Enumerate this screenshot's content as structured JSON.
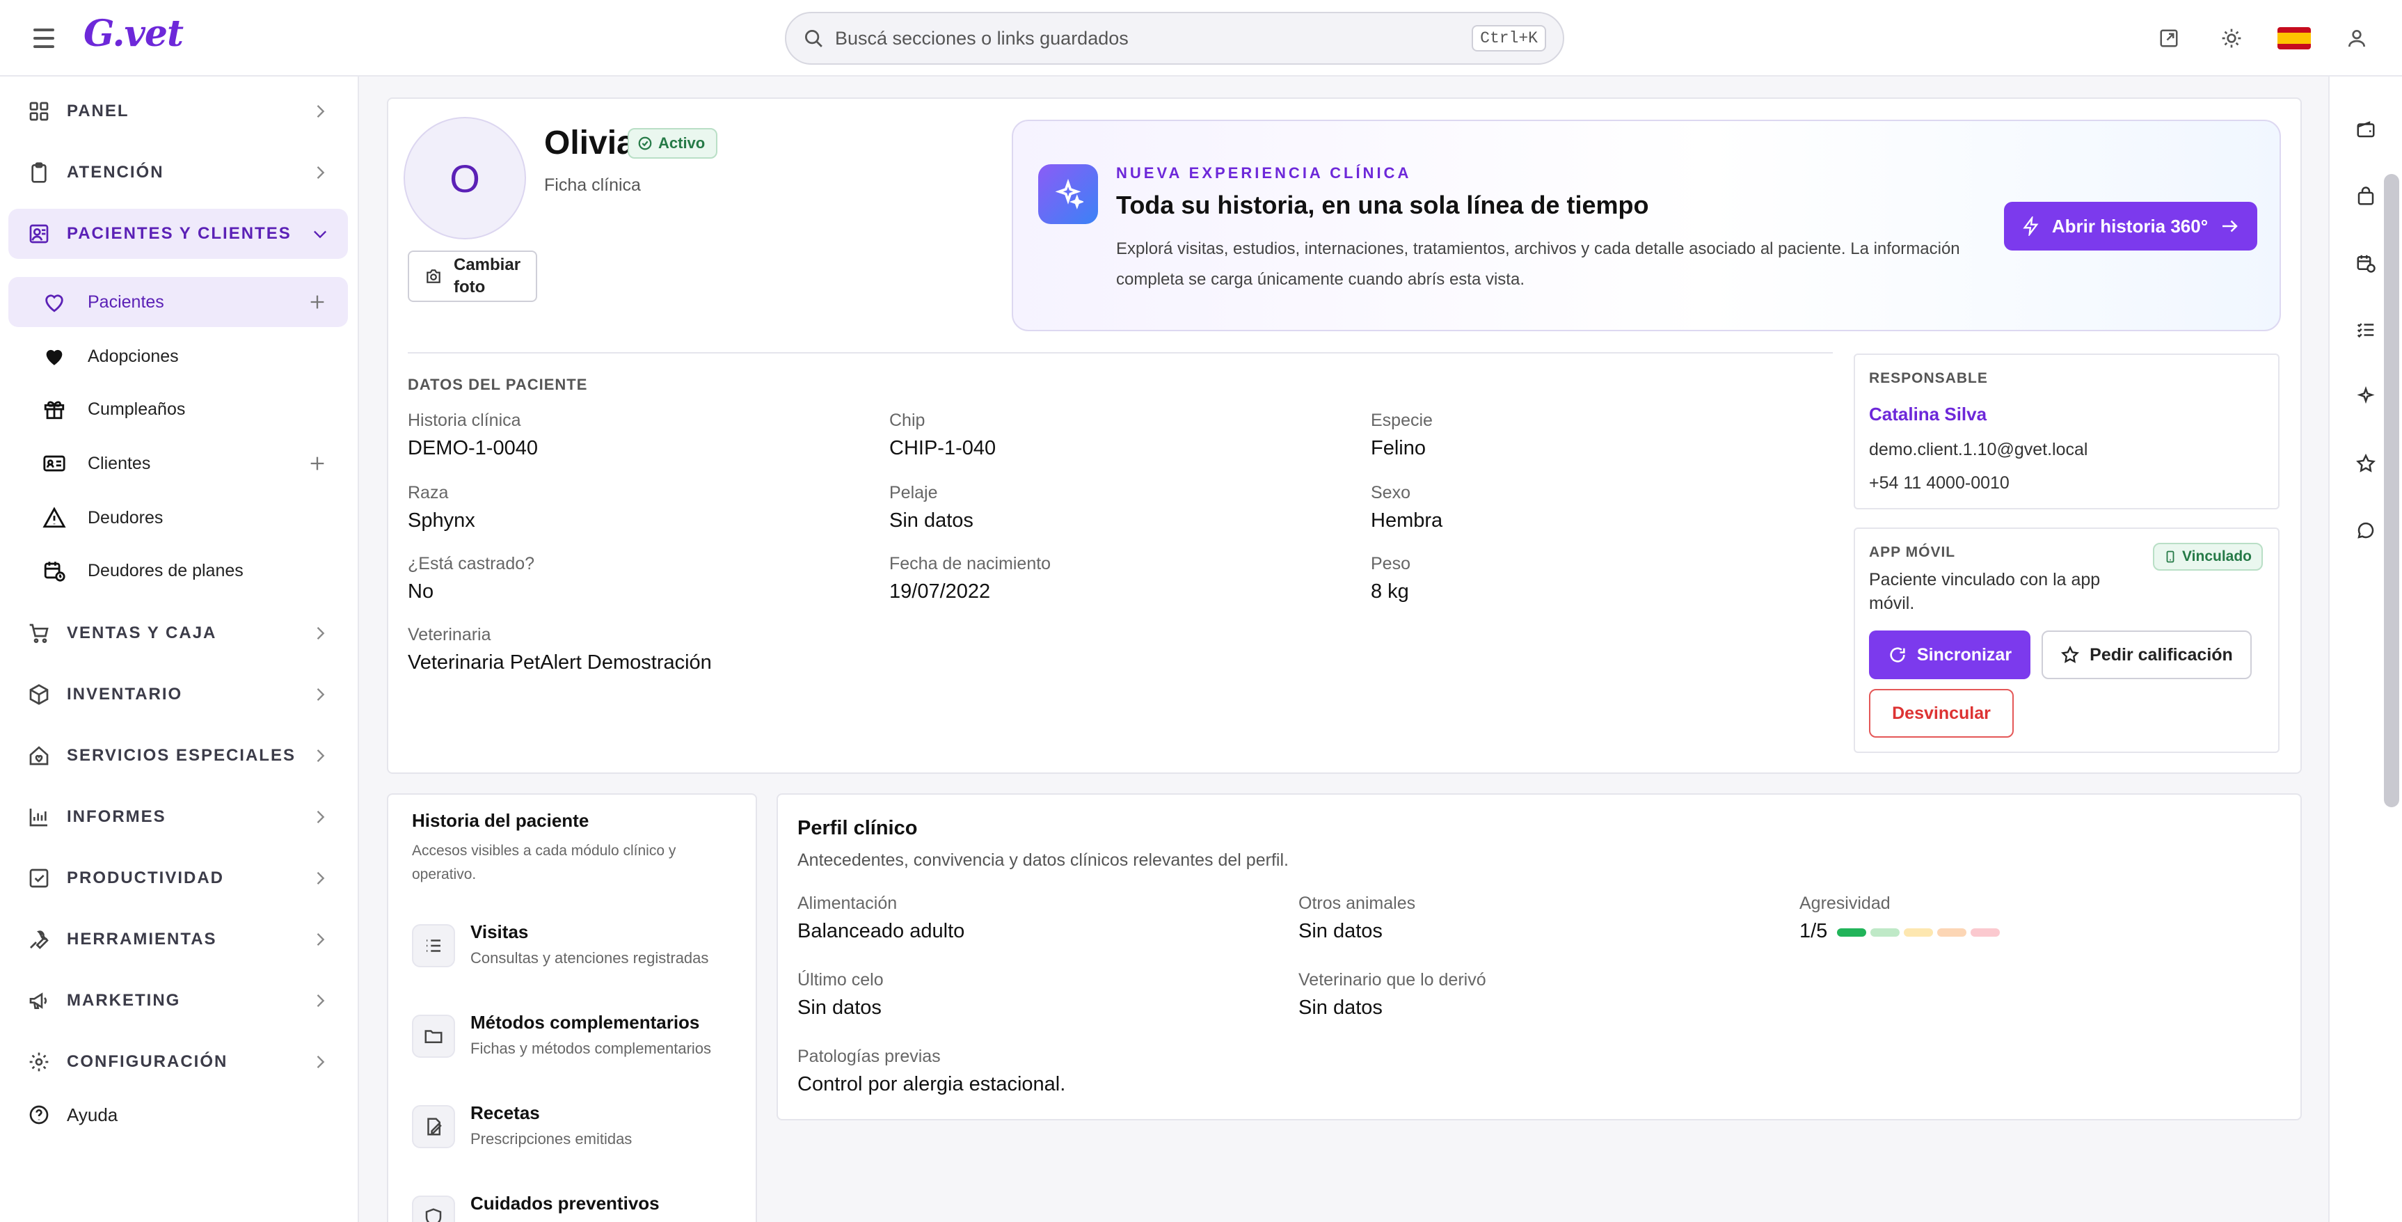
{
  "app": {
    "logo_text": "G.vet",
    "search_placeholder": "Buscá secciones o links guardados",
    "search_shortcut": "Ctrl+K"
  },
  "sidebar": {
    "items": [
      {
        "label": "PANEL",
        "icon": "grid-icon"
      },
      {
        "label": "ATENCIÓN",
        "icon": "clipboard-icon"
      },
      {
        "label": "PACIENTES Y CLIENTES",
        "icon": "patient-card-icon",
        "expanded": true
      },
      {
        "label": "VENTAS Y CAJA",
        "icon": "cart-icon"
      },
      {
        "label": "INVENTARIO",
        "icon": "box-icon"
      },
      {
        "label": "SERVICIOS ESPECIALES",
        "icon": "house-heart-icon"
      },
      {
        "label": "INFORMES",
        "icon": "bar-chart-icon"
      },
      {
        "label": "PRODUCTIVIDAD",
        "icon": "checkbox-icon"
      },
      {
        "label": "HERRAMIENTAS",
        "icon": "wrench-icon"
      },
      {
        "label": "MARKETING",
        "icon": "megaphone-icon"
      },
      {
        "label": "CONFIGURACIÓN",
        "icon": "gear-icon"
      }
    ],
    "sub_items": [
      {
        "label": "Pacientes",
        "icon": "heart-outline-icon"
      },
      {
        "label": "Adopciones",
        "icon": "heart-filled-icon"
      },
      {
        "label": "Cumpleaños",
        "icon": "gift-icon"
      },
      {
        "label": "Clientes",
        "icon": "id-card-icon"
      },
      {
        "label": "Deudores",
        "icon": "warning-icon"
      },
      {
        "label": "Deudores de planes",
        "icon": "calendar-clock-icon"
      }
    ],
    "help_label": "Ayuda"
  },
  "patient": {
    "avatar_initial": "O",
    "name": "Olivia",
    "status": "Activo",
    "subtitle": "Ficha clínica",
    "change_photo": "Cambiar foto"
  },
  "promo": {
    "kicker": "NUEVA EXPERIENCIA CLÍNICA",
    "title": "Toda su historia, en una sola línea de tiempo",
    "text": "Explorá visitas, estudios, internaciones, tratamientos, archivos y cada detalle asociado al paciente. La información completa se carga únicamente cuando abrís esta vista.",
    "button": "Abrir historia 360°"
  },
  "patient_data": {
    "section_title": "DATOS DEL PACIENTE",
    "fields": [
      {
        "label": "Historia clínica",
        "value": "DEMO-1-0040"
      },
      {
        "label": "Chip",
        "value": "CHIP-1-040"
      },
      {
        "label": "Especie",
        "value": "Felino"
      },
      {
        "label": "Raza",
        "value": "Sphynx"
      },
      {
        "label": "Pelaje",
        "value": "Sin datos"
      },
      {
        "label": "Sexo",
        "value": "Hembra"
      },
      {
        "label": "¿Está castrado?",
        "value": "No"
      },
      {
        "label": "Fecha de nacimiento",
        "value": "19/07/2022"
      },
      {
        "label": "Peso",
        "value": "8 kg"
      },
      {
        "label": "Veterinaria",
        "value": "Veterinaria PetAlert Demostración"
      }
    ]
  },
  "responsible": {
    "section_title": "RESPONSABLE",
    "name": "Catalina Silva",
    "email": "demo.client.1.10@gvet.local",
    "phone": "+54 11 4000-0010"
  },
  "mobile_app": {
    "section_title": "APP MÓVIL",
    "status_badge": "Vinculado",
    "text": "Paciente vinculado con la app móvil.",
    "sync_button": "Sincronizar",
    "rating_button": "Pedir calificación",
    "unlink_button": "Desvincular"
  },
  "history": {
    "title": "Historia del paciente",
    "subtitle": "Accesos visibles a cada módulo clínico y operativo.",
    "items": [
      {
        "title": "Visitas",
        "sub": "Consultas y atenciones registradas",
        "icon": "list-icon"
      },
      {
        "title": "Métodos complementarios",
        "sub": "Fichas y métodos complementarios",
        "icon": "folder-icon"
      },
      {
        "title": "Recetas",
        "sub": "Prescripciones emitidas",
        "icon": "prescription-icon"
      },
      {
        "title": "Cuidados preventivos",
        "sub": "",
        "icon": "shield-icon"
      }
    ]
  },
  "clinical_profile": {
    "title": "Perfil clínico",
    "subtitle": "Antecedentes, convivencia y datos clínicos relevantes del perfil.",
    "fields": [
      {
        "label": "Alimentación",
        "value": "Balanceado adulto"
      },
      {
        "label": "Otros animales",
        "value": "Sin datos"
      },
      {
        "label": "Último celo",
        "value": "Sin datos"
      },
      {
        "label": "Veterinario que lo derivó",
        "value": "Sin datos"
      },
      {
        "label": "Patologías previas",
        "value": "Control por alergia estacional."
      }
    ],
    "aggression": {
      "label": "Agresividad",
      "value_text": "1/5",
      "level": 1,
      "max": 5
    }
  },
  "colors": {
    "accent": "#7c3aed",
    "active_bg": "#efeafb",
    "success": "#267a47",
    "danger": "#d33333",
    "aggression_scale": [
      "#22b45a",
      "#bfe9c7",
      "#fde7b0",
      "#fcd6b5",
      "#fbc9cf"
    ]
  }
}
